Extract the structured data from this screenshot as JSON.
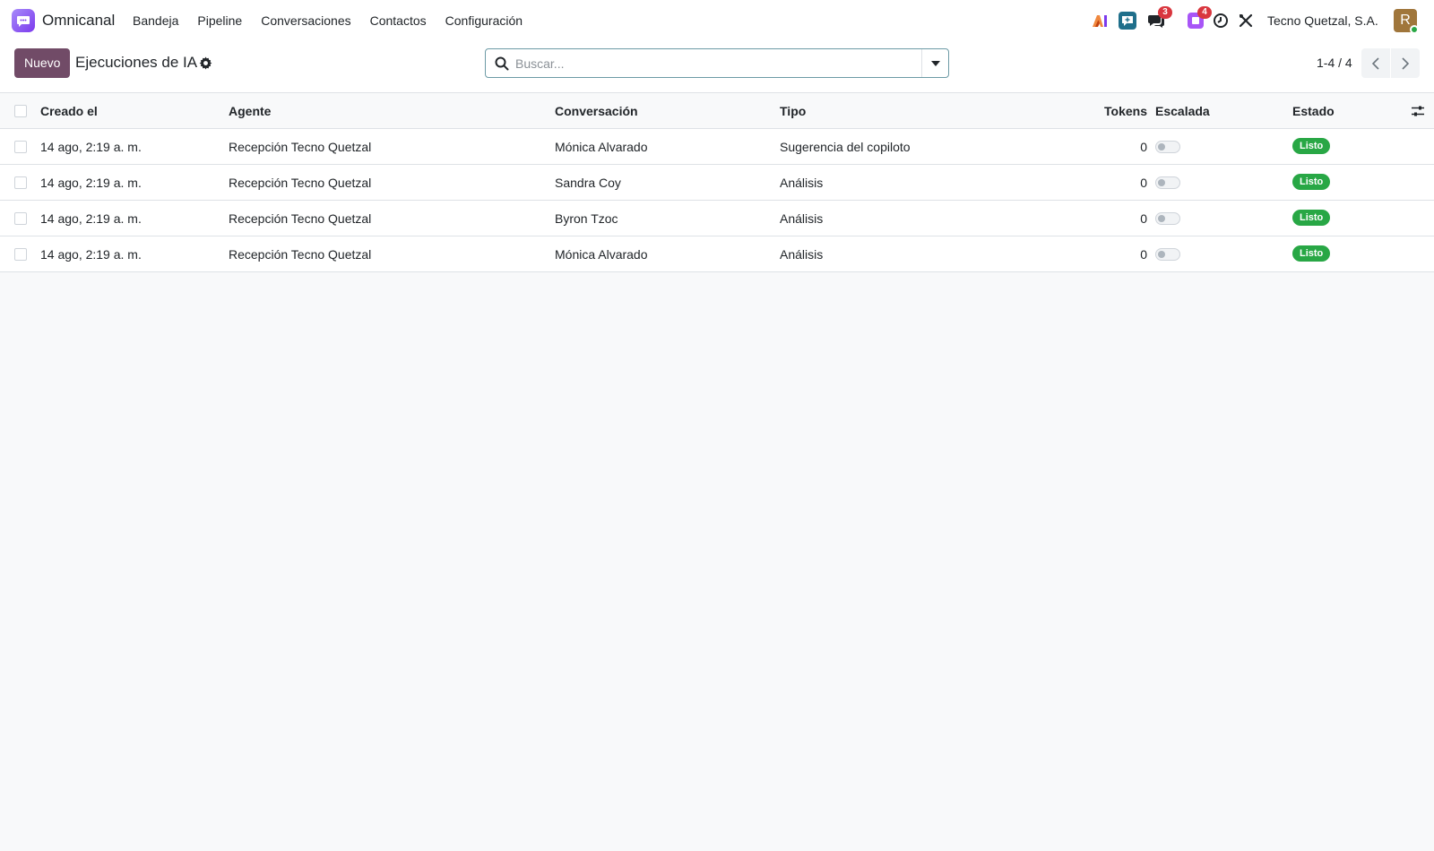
{
  "navbar": {
    "app_name": "Omnicanal",
    "menu": [
      "Bandeja",
      "Pipeline",
      "Conversaciones",
      "Contactos",
      "Configuración"
    ],
    "icons": [
      {
        "name": "ai-icon",
        "badge": ""
      },
      {
        "name": "chat-support-icon",
        "badge": ""
      },
      {
        "name": "messages-icon",
        "badge": "3"
      },
      {
        "name": "activities-icon",
        "badge": "4"
      },
      {
        "name": "clock-icon",
        "badge": ""
      },
      {
        "name": "debug-tools-icon",
        "badge": ""
      }
    ],
    "company": "Tecno Quetzal, S.A.",
    "avatar_initial": "R"
  },
  "control": {
    "new_label": "Nuevo",
    "title": "Ejecuciones de IA",
    "search_placeholder": "Buscar...",
    "pager": "1-4 / 4"
  },
  "table": {
    "headers": {
      "created": "Creado el",
      "agent": "Agente",
      "conversation": "Conversación",
      "type": "Tipo",
      "tokens": "Tokens",
      "escalated": "Escalada",
      "status": "Estado"
    },
    "rows": [
      {
        "created": "14 ago, 2:19 a. m.",
        "agent": "Recepción Tecno Quetzal",
        "conversation": "Mónica Alvarado",
        "type": "Sugerencia del copiloto",
        "tokens": "0",
        "escalated": false,
        "status": "Listo"
      },
      {
        "created": "14 ago, 2:19 a. m.",
        "agent": "Recepción Tecno Quetzal",
        "conversation": "Sandra Coy",
        "type": "Análisis",
        "tokens": "0",
        "escalated": false,
        "status": "Listo"
      },
      {
        "created": "14 ago, 2:19 a. m.",
        "agent": "Recepción Tecno Quetzal",
        "conversation": "Byron Tzoc",
        "type": "Análisis",
        "tokens": "0",
        "escalated": false,
        "status": "Listo"
      },
      {
        "created": "14 ago, 2:19 a. m.",
        "agent": "Recepción Tecno Quetzal",
        "conversation": "Mónica Alvarado",
        "type": "Análisis",
        "tokens": "0",
        "escalated": false,
        "status": "Listo"
      }
    ]
  },
  "colors": {
    "primary": "#714b67",
    "status_done": "#28a745",
    "badge": "#d9363e",
    "app_logo": "#7c3aed"
  }
}
